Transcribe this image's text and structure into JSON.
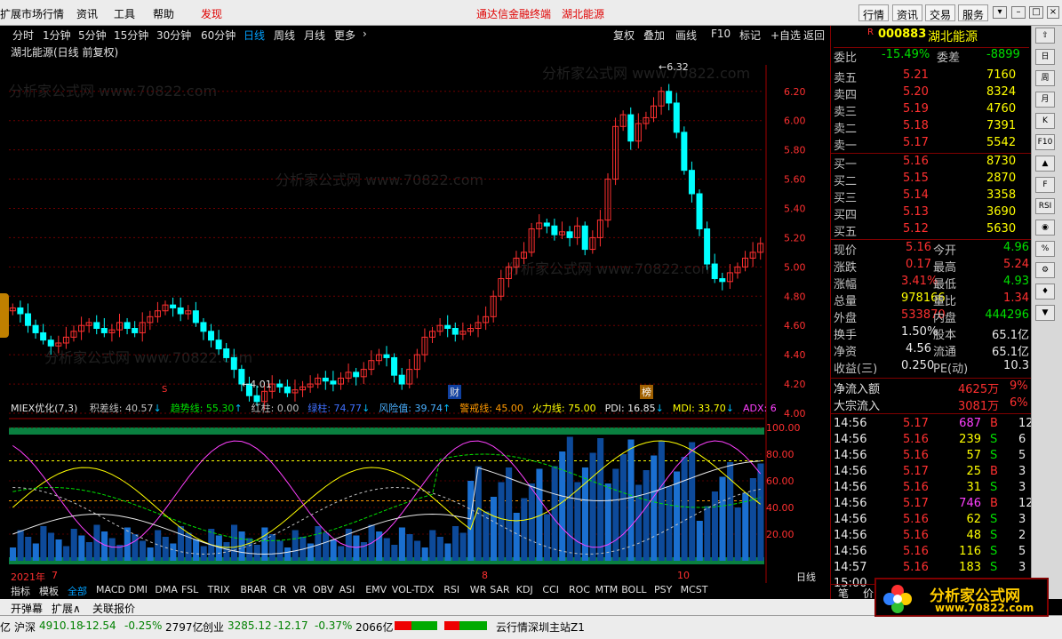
{
  "menubar": {
    "items": [
      "扩展市场行情",
      "资讯",
      "工具",
      "帮助"
    ],
    "discover": "发现",
    "center_title": "通达信金融终端",
    "center_stock": "湖北能源",
    "right_buttons": [
      "行情",
      "资讯",
      "交易",
      "服务"
    ]
  },
  "periodbar": {
    "periods": [
      "分时",
      "1分钟",
      "5分钟",
      "15分钟",
      "30分钟",
      "60分钟",
      "日线",
      "周线",
      "月线",
      "更多",
      "›"
    ],
    "selected": "日线",
    "tools": [
      "复权",
      "叠加",
      "画线",
      "F10",
      "标记",
      "+自选",
      "返回"
    ]
  },
  "chart_title": "湖北能源(日线 前复权)",
  "watermark": "分析家公式网 www.70822.com",
  "price_axis": [
    "6.20",
    "6.00",
    "5.80",
    "5.60",
    "5.40",
    "5.20",
    "5.00",
    "4.80",
    "4.60",
    "4.40",
    "4.20",
    "4.00"
  ],
  "annotations": {
    "high": "6.32",
    "low": "4.01",
    "cai": "财",
    "bang": "榜",
    "s": "S"
  },
  "chart_data": {
    "type": "candlestick",
    "high": 6.32,
    "low": 4.01,
    "ylim": [
      4.0,
      6.32
    ],
    "ind_axis": [
      "100.00",
      "80.00",
      "60.00",
      "40.00",
      "20.00"
    ]
  },
  "indicator": {
    "name": "MIEX优化(7,3)",
    "legend": [
      {
        "label": "积差线: 40.57",
        "color": "#c0c0c0",
        "arrow": "↓"
      },
      {
        "label": "趋势线: 55.30",
        "color": "#00e000",
        "arrow": "↑"
      },
      {
        "label": "红柱: 0.00",
        "color": "#c0c0c0",
        "arrow": ""
      },
      {
        "label": "绿柱: 74.77",
        "color": "#4070ff",
        "arrow": "↓"
      },
      {
        "label": "风险值: 39.74",
        "color": "#4ab0ff",
        "arrow": "↑"
      },
      {
        "label": "警戒线: 45.00",
        "color": "#ff9900",
        "arrow": ""
      },
      {
        "label": "火力线: 75.00",
        "color": "#ffff00",
        "arrow": ""
      },
      {
        "label": "PDI: 16.85",
        "color": "#e8e8e8",
        "arrow": "↓"
      },
      {
        "label": "MDI: 33.70",
        "color": "#ffff00",
        "arrow": "↓"
      },
      {
        "label": "ADX: 6",
        "color": "#ff40ff",
        "arrow": ""
      }
    ]
  },
  "date_axis": {
    "left": "2021年",
    "m7": "7",
    "m8": "8",
    "m10": "10",
    "rightlabel": "日线",
    "controls": [
      "+",
      "-",
      "0"
    ]
  },
  "stock": {
    "flag": "R",
    "code": "000883",
    "name": "湖北能源",
    "weibi_label": "委比",
    "weibi": "-15.49%",
    "weicha_label": "委差",
    "weicha": "-8899"
  },
  "sells": [
    {
      "label": "卖五",
      "price": "5.21",
      "vol": "7160"
    },
    {
      "label": "卖四",
      "price": "5.20",
      "vol": "8324"
    },
    {
      "label": "卖三",
      "price": "5.19",
      "vol": "4760"
    },
    {
      "label": "卖二",
      "price": "5.18",
      "vol": "7391"
    },
    {
      "label": "卖一",
      "price": "5.17",
      "vol": "5542"
    }
  ],
  "buys": [
    {
      "label": "买一",
      "price": "5.16",
      "vol": "8730"
    },
    {
      "label": "买二",
      "price": "5.15",
      "vol": "2870"
    },
    {
      "label": "买三",
      "price": "5.14",
      "vol": "3358"
    },
    {
      "label": "买四",
      "price": "5.13",
      "vol": "3690"
    },
    {
      "label": "买五",
      "price": "5.12",
      "vol": "5630"
    }
  ],
  "quote": [
    {
      "l1": "现价",
      "v1": "5.16",
      "c1": "red",
      "l2": "今开",
      "v2": "4.96",
      "c2": "grn"
    },
    {
      "l1": "涨跌",
      "v1": "0.17",
      "c1": "red",
      "l2": "最高",
      "v2": "5.24",
      "c2": "red"
    },
    {
      "l1": "涨幅",
      "v1": "3.41%",
      "c1": "red",
      "l2": "最低",
      "v2": "4.93",
      "c2": "grn"
    },
    {
      "l1": "总量",
      "v1": "978166",
      "c1": "yel",
      "l2": "量比",
      "v2": "1.34",
      "c2": "red"
    },
    {
      "l1": "外盘",
      "v1": "533870",
      "c1": "red",
      "l2": "内盘",
      "v2": "444296",
      "c2": "grn"
    },
    {
      "l1": "换手",
      "v1": "1.50%",
      "c1": "wht",
      "l2": "股本",
      "v2": "65.1亿",
      "c2": "wht"
    },
    {
      "l1": "净资",
      "v1": "4.56",
      "c1": "wht",
      "l2": "流通",
      "v2": "65.1亿",
      "c2": "wht"
    },
    {
      "l1": "收益(三)",
      "v1": "0.250",
      "c1": "wht",
      "l2": "PE(动)",
      "v2": "10.3",
      "c2": "wht"
    }
  ],
  "flows": [
    {
      "label": "净流入额",
      "val": "4625万",
      "pct": "9%"
    },
    {
      "label": "大宗流入",
      "val": "3081万",
      "pct": "6%"
    }
  ],
  "ticks": [
    {
      "t": "14:56",
      "p": "5.17",
      "v": "687",
      "bs": "B",
      "n": "12"
    },
    {
      "t": "14:56",
      "p": "5.16",
      "v": "239",
      "bs": "S",
      "n": "6"
    },
    {
      "t": "14:56",
      "p": "5.16",
      "v": "57",
      "bs": "S",
      "n": "5"
    },
    {
      "t": "14:56",
      "p": "5.17",
      "v": "25",
      "bs": "B",
      "n": "3"
    },
    {
      "t": "14:56",
      "p": "5.16",
      "v": "31",
      "bs": "S",
      "n": "3"
    },
    {
      "t": "14:56",
      "p": "5.17",
      "v": "746",
      "bs": "B",
      "n": "12"
    },
    {
      "t": "14:56",
      "p": "5.16",
      "v": "62",
      "bs": "S",
      "n": "3"
    },
    {
      "t": "14:56",
      "p": "5.16",
      "v": "48",
      "bs": "S",
      "n": "2"
    },
    {
      "t": "14:56",
      "p": "5.16",
      "v": "116",
      "bs": "S",
      "n": "5"
    },
    {
      "t": "14:57",
      "p": "5.16",
      "v": "183",
      "bs": "S",
      "n": "3"
    },
    {
      "t": "15:00",
      "p": "5.16",
      "v": "",
      "bs": "",
      "n": ""
    }
  ],
  "panel_tabs": [
    "笔",
    "价"
  ],
  "ind_tabs": [
    "指标",
    "模板",
    "全部",
    "MACD",
    "DMI",
    "DMA",
    "FSL",
    "TRIX",
    "BRAR",
    "CR",
    "VR",
    "OBV",
    "ASI",
    "EMV",
    "VOL-TDX",
    "RSI",
    "WR",
    "SAR",
    "KDJ",
    "CCI",
    "ROC",
    "MTM",
    "BOLL",
    "PSY",
    "MCST"
  ],
  "footer": [
    "开弹幕",
    "扩展∧",
    "关联报价"
  ],
  "status": {
    "prefix": "亿",
    "sh_label": "沪深",
    "sh": "4910.18",
    "sh_chg": "-12.54",
    "sh_pct": "-0.25%",
    "sh_amt": "2797亿",
    "cy_label": "创业",
    "cy": "3285.12",
    "cy_chg": "-12.17",
    "cy_pct": "-0.37%",
    "cy_amt": "2066亿",
    "server": "云行情深圳主站Z1"
  },
  "logo": {
    "t1": "分析家公式网",
    "t2": "www.70822.com"
  },
  "sidebar": [
    "⇧",
    "日",
    "周",
    "月",
    "K",
    "F10",
    "▲",
    "F",
    "RSI",
    "◉",
    "%",
    "⚙",
    "♦",
    "▼"
  ]
}
